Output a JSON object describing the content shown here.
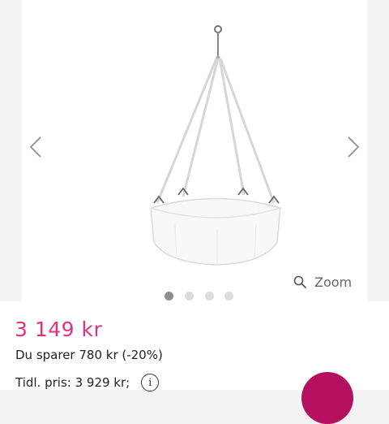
{
  "gallery": {
    "image_subject": "hanging cradle",
    "prev_icon": "chevron-left-icon",
    "next_icon": "chevron-right-icon",
    "zoom_icon": "magnifier-icon",
    "zoom_label": "Zoom",
    "slide_count": 4,
    "active_slide": 1
  },
  "product": {
    "price": "3 149 kr",
    "saving": "Du sparer 780 kr (-20%)",
    "previous_price": "Tidl. pris: 3 929 kr;",
    "info_icon": "i"
  },
  "colors": {
    "price": "#e0327f",
    "accent_button": "#b4105f",
    "dot_active": "#8f8f8f",
    "dot_inactive": "#dcdcdc"
  }
}
